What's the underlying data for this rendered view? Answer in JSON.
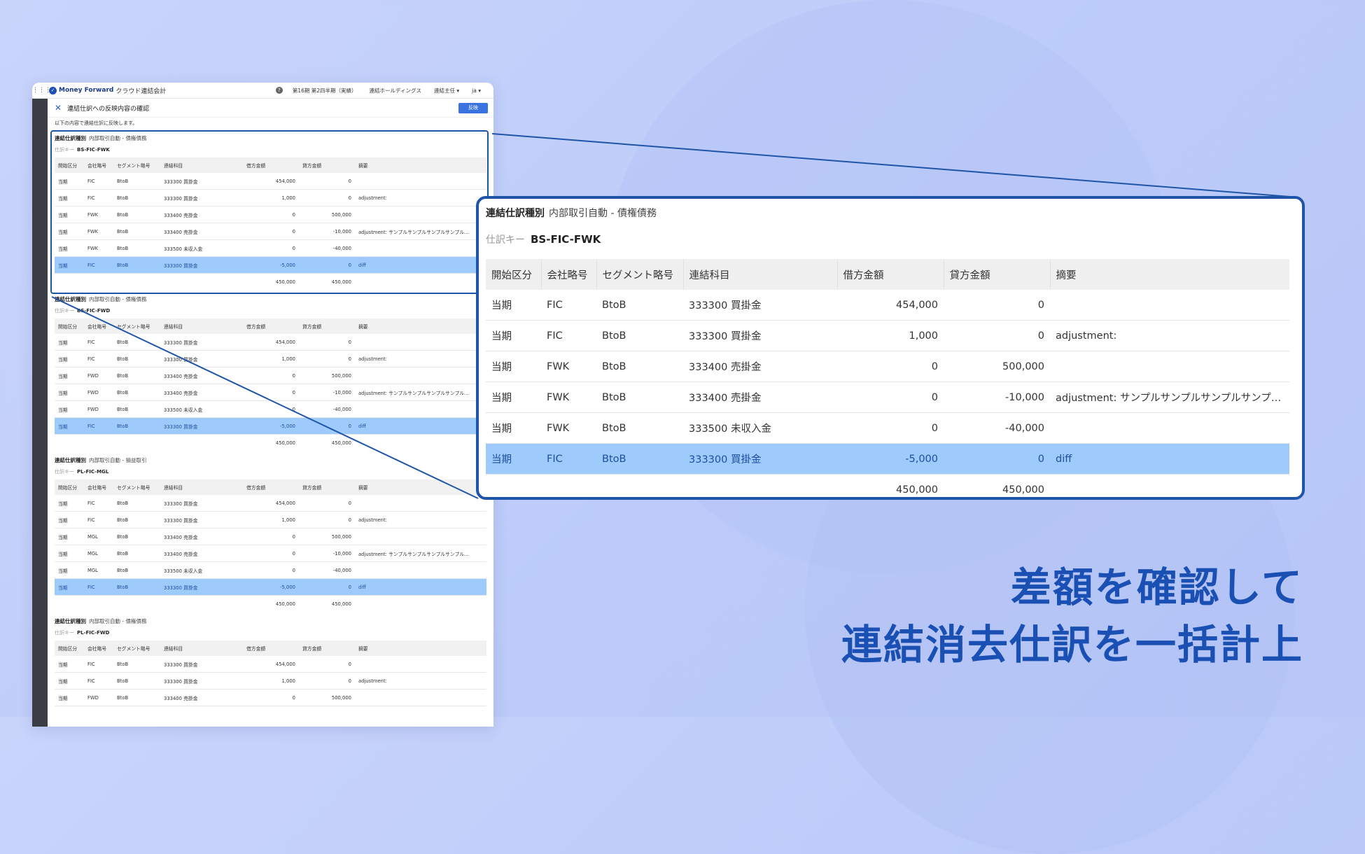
{
  "app": {
    "logo_text": "Money Forward",
    "logo_sub": "クラウド連結会計",
    "period": "第16期 第2四半期（実績）",
    "company": "連結ホールディングス",
    "user": "連結主任",
    "lang": "ja",
    "page_title": "連結仕訳への反映内容の確認",
    "apply_label": "反映",
    "note": "以下の内容で連結仕訳に反映します。"
  },
  "labels": {
    "type_label": "連結仕訳種別",
    "key_label": "仕訳キー"
  },
  "columns": [
    "開始区分",
    "会社略号",
    "セグメント略号",
    "連結科目",
    "借方金額",
    "貸方金額",
    "摘要"
  ],
  "sections": [
    {
      "type": "内部取引自動 - 債権債務",
      "key": "BS-FIC-FWK",
      "rows": [
        [
          "当期",
          "FIC",
          "BtoB",
          "333300 買掛金",
          "454,000",
          "0",
          ""
        ],
        [
          "当期",
          "FIC",
          "BtoB",
          "333300 買掛金",
          "1,000",
          "0",
          "adjustment:"
        ],
        [
          "当期",
          "FWK",
          "BtoB",
          "333400 売掛金",
          "0",
          "500,000",
          ""
        ],
        [
          "当期",
          "FWK",
          "BtoB",
          "333400 売掛金",
          "0",
          "-10,000",
          "adjustment: サンプルサンプルサンプルサンプル..."
        ],
        [
          "当期",
          "FWK",
          "BtoB",
          "333500 未収入金",
          "0",
          "-40,000",
          ""
        ],
        [
          "当期",
          "FIC",
          "BtoB",
          "333300 買掛金",
          "-5,000",
          "0",
          "diff"
        ]
      ],
      "total_debit": "450,000",
      "total_credit": "450,000"
    },
    {
      "type": "内部取引自動 - 債権債務",
      "key": "BS-FIC-FWD",
      "rows": [
        [
          "当期",
          "FIC",
          "BtoB",
          "333300 買掛金",
          "454,000",
          "0",
          ""
        ],
        [
          "当期",
          "FIC",
          "BtoB",
          "333300 買掛金",
          "1,000",
          "0",
          "adjustment:"
        ],
        [
          "当期",
          "FWD",
          "BtoB",
          "333400 売掛金",
          "0",
          "500,000",
          ""
        ],
        [
          "当期",
          "FWD",
          "BtoB",
          "333400 売掛金",
          "0",
          "-10,000",
          "adjustment: サンプルサンプルサンプルサンプル..."
        ],
        [
          "当期",
          "FWD",
          "BtoB",
          "333500 未収入金",
          "0",
          "-40,000",
          ""
        ],
        [
          "当期",
          "FIC",
          "BtoB",
          "333300 買掛金",
          "-5,000",
          "0",
          "diff"
        ]
      ],
      "total_debit": "450,000",
      "total_credit": "450,000"
    },
    {
      "type": "内部取引自動 - 損益取引",
      "key": "PL-FIC-MGL",
      "rows": [
        [
          "当期",
          "FIC",
          "BtoB",
          "333300 買掛金",
          "454,000",
          "0",
          ""
        ],
        [
          "当期",
          "FIC",
          "BtoB",
          "333300 買掛金",
          "1,000",
          "0",
          "adjustment:"
        ],
        [
          "当期",
          "MGL",
          "BtoB",
          "333400 売掛金",
          "0",
          "500,000",
          ""
        ],
        [
          "当期",
          "MGL",
          "BtoB",
          "333400 売掛金",
          "0",
          "-10,000",
          "adjustment: サンプルサンプルサンプルサンプル..."
        ],
        [
          "当期",
          "MGL",
          "BtoB",
          "333500 未収入金",
          "0",
          "-40,000",
          ""
        ],
        [
          "当期",
          "FIC",
          "BtoB",
          "333300 買掛金",
          "-5,000",
          "0",
          "diff"
        ]
      ],
      "total_debit": "450,000",
      "total_credit": "450,000"
    },
    {
      "type": "内部取引自動 - 債権債務",
      "key": "PL-FIC-FWD",
      "rows": [
        [
          "当期",
          "FIC",
          "BtoB",
          "333300 買掛金",
          "454,000",
          "0",
          ""
        ],
        [
          "当期",
          "FIC",
          "BtoB",
          "333300 買掛金",
          "1,000",
          "0",
          "adjustment:"
        ],
        [
          "当期",
          "FWD",
          "BtoB",
          "333400 売掛金",
          "0",
          "500,000",
          ""
        ]
      ],
      "total_debit": "",
      "total_credit": ""
    }
  ],
  "headline": {
    "line1": "差額を確認して",
    "line2": "連結消去仕訳を一括計上"
  },
  "colors": {
    "accent": "#1f55a8",
    "highlight_row": "#9fcafc",
    "headline": "#1a4fb3"
  }
}
